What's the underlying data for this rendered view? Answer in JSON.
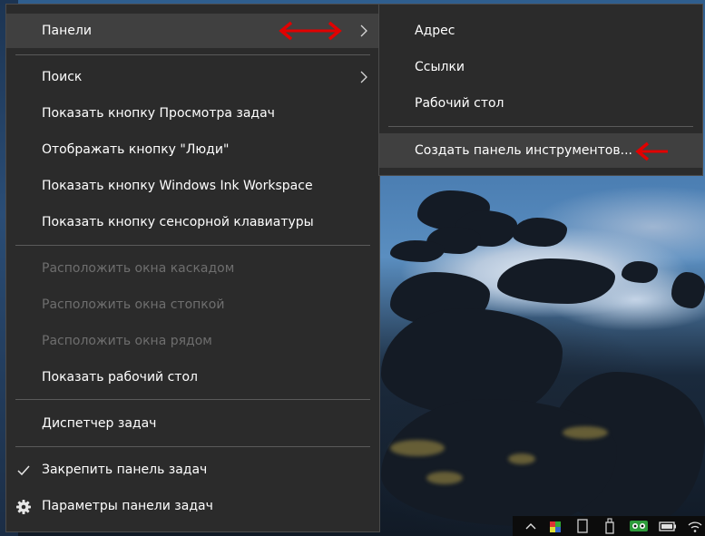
{
  "context_menu": {
    "items": [
      {
        "label": "Панели"
      },
      {
        "label": "Поиск"
      },
      {
        "label": "Показать кнопку Просмотра задач"
      },
      {
        "label": "Отображать кнопку \"Люди\""
      },
      {
        "label": "Показать кнопку Windows Ink Workspace"
      },
      {
        "label": "Показать кнопку сенсорной клавиатуры"
      },
      {
        "label": "Расположить окна каскадом",
        "enabled": false
      },
      {
        "label": "Расположить окна стопкой",
        "enabled": false
      },
      {
        "label": "Расположить окна рядом",
        "enabled": false
      },
      {
        "label": "Показать рабочий стол"
      },
      {
        "label": "Диспетчер задач"
      },
      {
        "label": "Закрепить панель задач",
        "checked": true
      },
      {
        "label": "Параметры панели задач",
        "icon": "gear-icon"
      }
    ]
  },
  "submenu": {
    "items": [
      {
        "label": "Адрес"
      },
      {
        "label": "Ссылки"
      },
      {
        "label": "Рабочий стол"
      },
      {
        "label": "Создать панель инструментов..."
      }
    ]
  },
  "annotations": {
    "arrow_color": "#e10000"
  },
  "tray": {
    "icons": [
      "show-hidden-icons-chevron",
      "cube-app-icon",
      "tablet-icon",
      "usb-drive-icon",
      "roboform-icon",
      "battery-icon",
      "wifi-icon"
    ]
  }
}
